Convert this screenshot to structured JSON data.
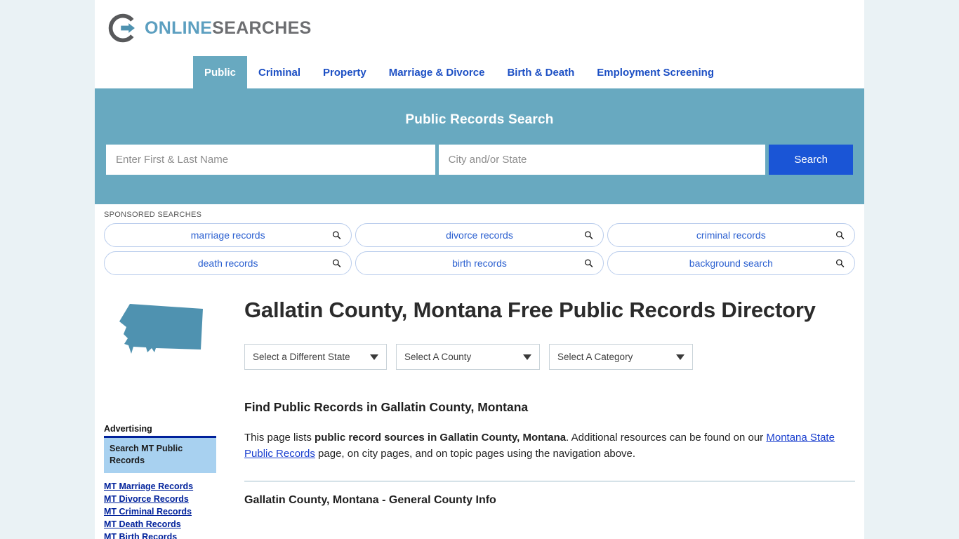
{
  "brand": {
    "logo_icon": "circle-arrow-logo-icon",
    "name_part1": "ONLINE",
    "name_part2": "SEARCHES",
    "accent_color": "#68a9c0",
    "link_color": "#1c4fc4"
  },
  "nav": {
    "tabs": [
      {
        "label": "Public",
        "active": true
      },
      {
        "label": "Criminal",
        "active": false
      },
      {
        "label": "Property",
        "active": false
      },
      {
        "label": "Marriage & Divorce",
        "active": false
      },
      {
        "label": "Birth & Death",
        "active": false
      },
      {
        "label": "Employment Screening",
        "active": false
      }
    ]
  },
  "hero": {
    "title": "Public Records Search",
    "name_value": "",
    "name_placeholder": "Enter First & Last Name",
    "location_value": "",
    "location_placeholder": "City and/or State",
    "search_button": "Search",
    "search_button_color": "#1a55d6",
    "background_color": "#68a9c0"
  },
  "sponsored": {
    "label": "SPONSORED SEARCHES",
    "pills": [
      "marriage records",
      "divorce records",
      "criminal records",
      "death records",
      "birth records",
      "background search"
    ],
    "pill_icon": "search-icon"
  },
  "main": {
    "state_map_icon": "montana-state-map-icon",
    "state_map_color": "#4f92b0",
    "page_title": "Gallatin County, Montana Free Public Records Directory",
    "selectors": [
      {
        "name": "state",
        "value": "Select a Different State"
      },
      {
        "name": "county",
        "value": "Select A County"
      },
      {
        "name": "category",
        "value": "Select A Category"
      }
    ],
    "section_title": "Find Public Records in Gallatin County, Montana",
    "intro": {
      "part1": "This page lists ",
      "bold1": "public record sources in Gallatin County, Montana",
      "part2": ". Additional resources can be found on our ",
      "link": "Montana State Public Records",
      "part3": " page, on city pages, and on topic pages using the navigation above."
    },
    "county_info_heading": "Gallatin County, Montana - General County Info"
  },
  "sidebar": {
    "advertising_label": "Advertising",
    "ad_box_text": "Search MT Public Records",
    "links": [
      "MT Marriage Records",
      "MT Divorce Records",
      "MT Criminal Records",
      "MT Death Records",
      "MT Birth Records"
    ],
    "link_color": "#00219b"
  }
}
